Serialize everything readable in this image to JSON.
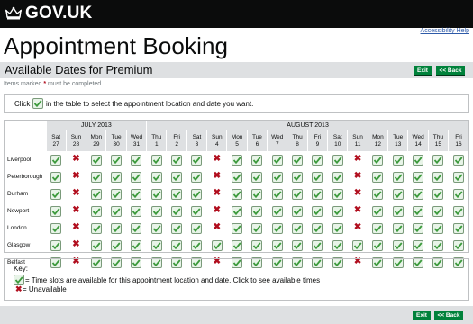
{
  "header": {
    "logo_text": "GOV.UK",
    "crown_icon": "crown-icon"
  },
  "accessibility_link": "Accessibility Help",
  "page_title": "Appointment Booking",
  "subheader": {
    "title": "Available Dates for Premium",
    "exit_label": "Exit",
    "back_label": "<< Back"
  },
  "required_note": {
    "pre": "Items marked",
    "star": "*",
    "post": "must be completed"
  },
  "instruction": {
    "pre": "Click",
    "post": "in the table to select the appointment location and date you want."
  },
  "grid": {
    "months": [
      {
        "label": "JULY 2013",
        "span": 5
      },
      {
        "label": "AUGUST 2013",
        "span": 16
      }
    ],
    "days": [
      {
        "dow": "Sat",
        "num": "27"
      },
      {
        "dow": "Sun",
        "num": "28"
      },
      {
        "dow": "Mon",
        "num": "29"
      },
      {
        "dow": "Tue",
        "num": "30"
      },
      {
        "dow": "Wed",
        "num": "31"
      },
      {
        "dow": "Thu",
        "num": "1"
      },
      {
        "dow": "Fri",
        "num": "2"
      },
      {
        "dow": "Sat",
        "num": "3"
      },
      {
        "dow": "Sun",
        "num": "4"
      },
      {
        "dow": "Mon",
        "num": "5"
      },
      {
        "dow": "Tue",
        "num": "6"
      },
      {
        "dow": "Wed",
        "num": "7"
      },
      {
        "dow": "Thu",
        "num": "8"
      },
      {
        "dow": "Fri",
        "num": "9"
      },
      {
        "dow": "Sat",
        "num": "10"
      },
      {
        "dow": "Sun",
        "num": "11"
      },
      {
        "dow": "Mon",
        "num": "12"
      },
      {
        "dow": "Tue",
        "num": "13"
      },
      {
        "dow": "Wed",
        "num": "14"
      },
      {
        "dow": "Thu",
        "num": "15"
      },
      {
        "dow": "Fri",
        "num": "16"
      }
    ],
    "locations": [
      {
        "name": "Liverpool",
        "slots": [
          1,
          0,
          1,
          1,
          1,
          1,
          1,
          1,
          0,
          1,
          1,
          1,
          1,
          1,
          1,
          0,
          1,
          1,
          1,
          1,
          1
        ]
      },
      {
        "name": "Peterborough",
        "slots": [
          1,
          0,
          1,
          1,
          1,
          1,
          1,
          1,
          0,
          1,
          1,
          1,
          1,
          1,
          1,
          0,
          1,
          1,
          1,
          1,
          1
        ]
      },
      {
        "name": "Durham",
        "slots": [
          1,
          0,
          1,
          1,
          1,
          1,
          1,
          1,
          0,
          1,
          1,
          1,
          1,
          1,
          1,
          0,
          1,
          1,
          1,
          1,
          1
        ]
      },
      {
        "name": "Newport",
        "slots": [
          1,
          0,
          1,
          1,
          1,
          1,
          1,
          1,
          0,
          1,
          1,
          1,
          1,
          1,
          1,
          0,
          1,
          1,
          1,
          1,
          1
        ]
      },
      {
        "name": "London",
        "slots": [
          1,
          0,
          1,
          1,
          1,
          1,
          1,
          1,
          0,
          1,
          1,
          1,
          1,
          1,
          1,
          0,
          1,
          1,
          1,
          1,
          1
        ]
      },
      {
        "name": "Glasgow",
        "slots": [
          1,
          0,
          1,
          1,
          1,
          1,
          1,
          1,
          1,
          1,
          1,
          1,
          1,
          1,
          1,
          1,
          1,
          1,
          1,
          1,
          1
        ]
      },
      {
        "name": "Belfast",
        "slots": [
          1,
          0,
          1,
          1,
          1,
          1,
          1,
          1,
          0,
          1,
          1,
          1,
          1,
          1,
          1,
          0,
          1,
          1,
          1,
          1,
          1
        ]
      }
    ]
  },
  "key": {
    "title": "Key:",
    "available": "= Time slots are available for this appointment location and date. Click to see available times",
    "cross_symbol": "✖",
    "unavailable": "= Unavailable"
  },
  "colors": {
    "tick_green": "#5fb35f",
    "cross_red": "#b10e1e",
    "button_green": "#00823b",
    "header_black": "#0b0c0c",
    "grey_bar": "#dee0e2"
  }
}
